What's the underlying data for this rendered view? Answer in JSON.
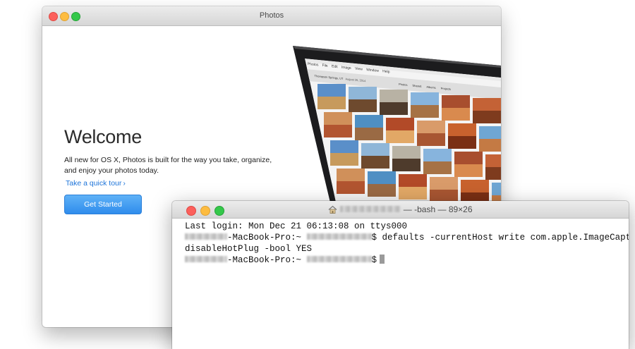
{
  "photos_window": {
    "title": "Photos",
    "welcome_title": "Welcome",
    "description": "All new for OS X, Photos is built for the way you take, organize, and enjoy your photos today.",
    "tour_link": "Take a quick tour",
    "tour_chevron": "›",
    "get_started": "Get Started",
    "accent_color": "#1d74d9"
  },
  "laptop_screen": {
    "menu_items": [
      "Photos",
      "File",
      "Edit",
      "Image",
      "View",
      "Window",
      "Help"
    ],
    "album_title": "Thompson Springs, UT",
    "album_date": "August 26, 2014",
    "tabs": [
      "Photos",
      "Shared",
      "Albums",
      "Projects"
    ]
  },
  "terminal": {
    "title_suffix": "— -bash — 89×26",
    "lines": {
      "line1": "Last login: Mon Dec 21 06:13:08 on ttys000",
      "line2_host": "-MacBook-Pro:~",
      "line2_cmd": "$ defaults -currentHost write com.apple.ImageCapture ]",
      "line3": "disableHotPlug -bool YES",
      "line4_host": "-MacBook-Pro:~",
      "line4_prompt": "$"
    },
    "icon": "home-icon"
  }
}
